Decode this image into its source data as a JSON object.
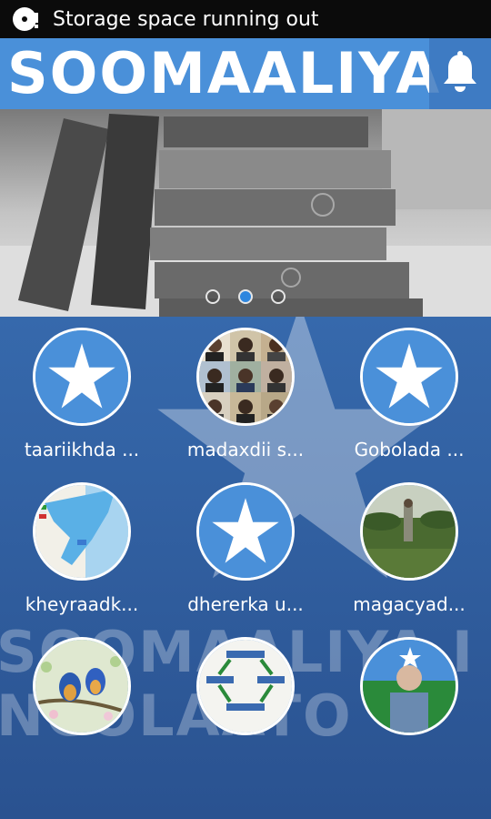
{
  "status_bar": {
    "notification_icon": "storage-warning-icon",
    "message": "Storage space running out"
  },
  "app_bar": {
    "logo_text": "SOOMAALIYA",
    "notification_icon": "bell-icon"
  },
  "banner": {
    "slide_count": 3,
    "active_slide": 2
  },
  "background": {
    "watermark_line1": "SOOMAALIYA I",
    "watermark_line2": "NCOLAATO"
  },
  "tiles": [
    {
      "label": "taariikhda ...",
      "image": "somali-star-icon"
    },
    {
      "label": "madaxdii s...",
      "image": "leaders-collage-image"
    },
    {
      "label": "Gobolada ...",
      "image": "somali-star-icon"
    },
    {
      "label": "kheyraadk...",
      "image": "somalia-map-image"
    },
    {
      "label": "dhererka u...",
      "image": "somali-star-icon"
    },
    {
      "label": "magacyad...",
      "image": "field-landscape-image"
    },
    {
      "label": "",
      "image": "birds-image"
    },
    {
      "label": "",
      "image": "diagram-paper-image"
    },
    {
      "label": "",
      "image": "person-flag-image"
    }
  ],
  "colors": {
    "accent": "#4a90d9",
    "background": "#2f5d9c",
    "status_bar": "#0b0b0b"
  }
}
